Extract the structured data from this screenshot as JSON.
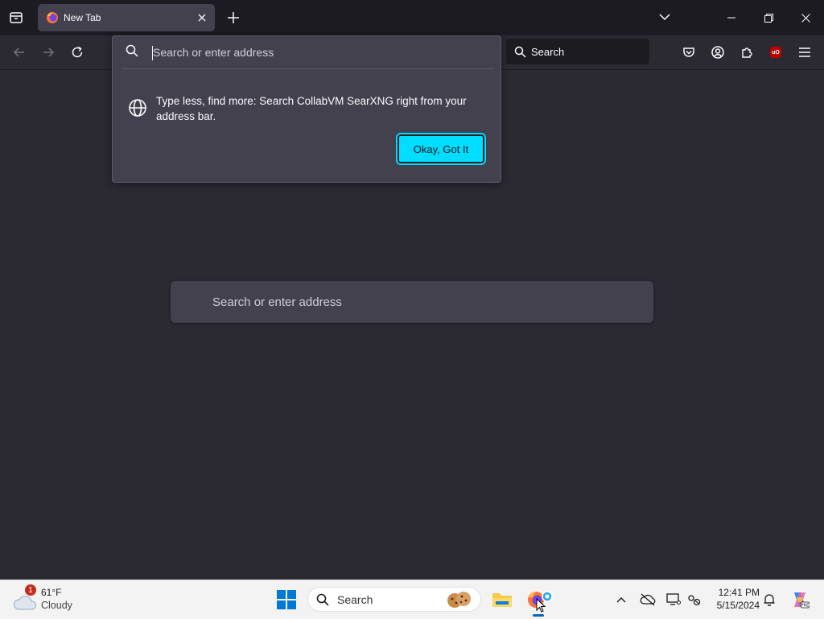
{
  "browser": {
    "tab": {
      "title": "New Tab"
    },
    "nav": {
      "search_label": "Search"
    },
    "urlbar": {
      "placeholder": "Search or enter address",
      "tip_text": "Type less, find more: Search CollabVM SearXNG right from your address bar.",
      "okay_button": "Okay, Got It"
    },
    "page": {
      "search_placeholder": "Search or enter address"
    }
  },
  "colors": {
    "accent": "#00ddff",
    "toolbar": "#2b2a33",
    "tabstrip": "#1c1b22",
    "popup": "#42414d"
  },
  "taskbar": {
    "weather": {
      "temperature": "61°F",
      "condition": "Cloudy",
      "badge": "1"
    },
    "search_label": "Search",
    "clock": {
      "time": "12:41 PM",
      "date": "5/15/2024"
    },
    "extension_badge": "uO"
  }
}
